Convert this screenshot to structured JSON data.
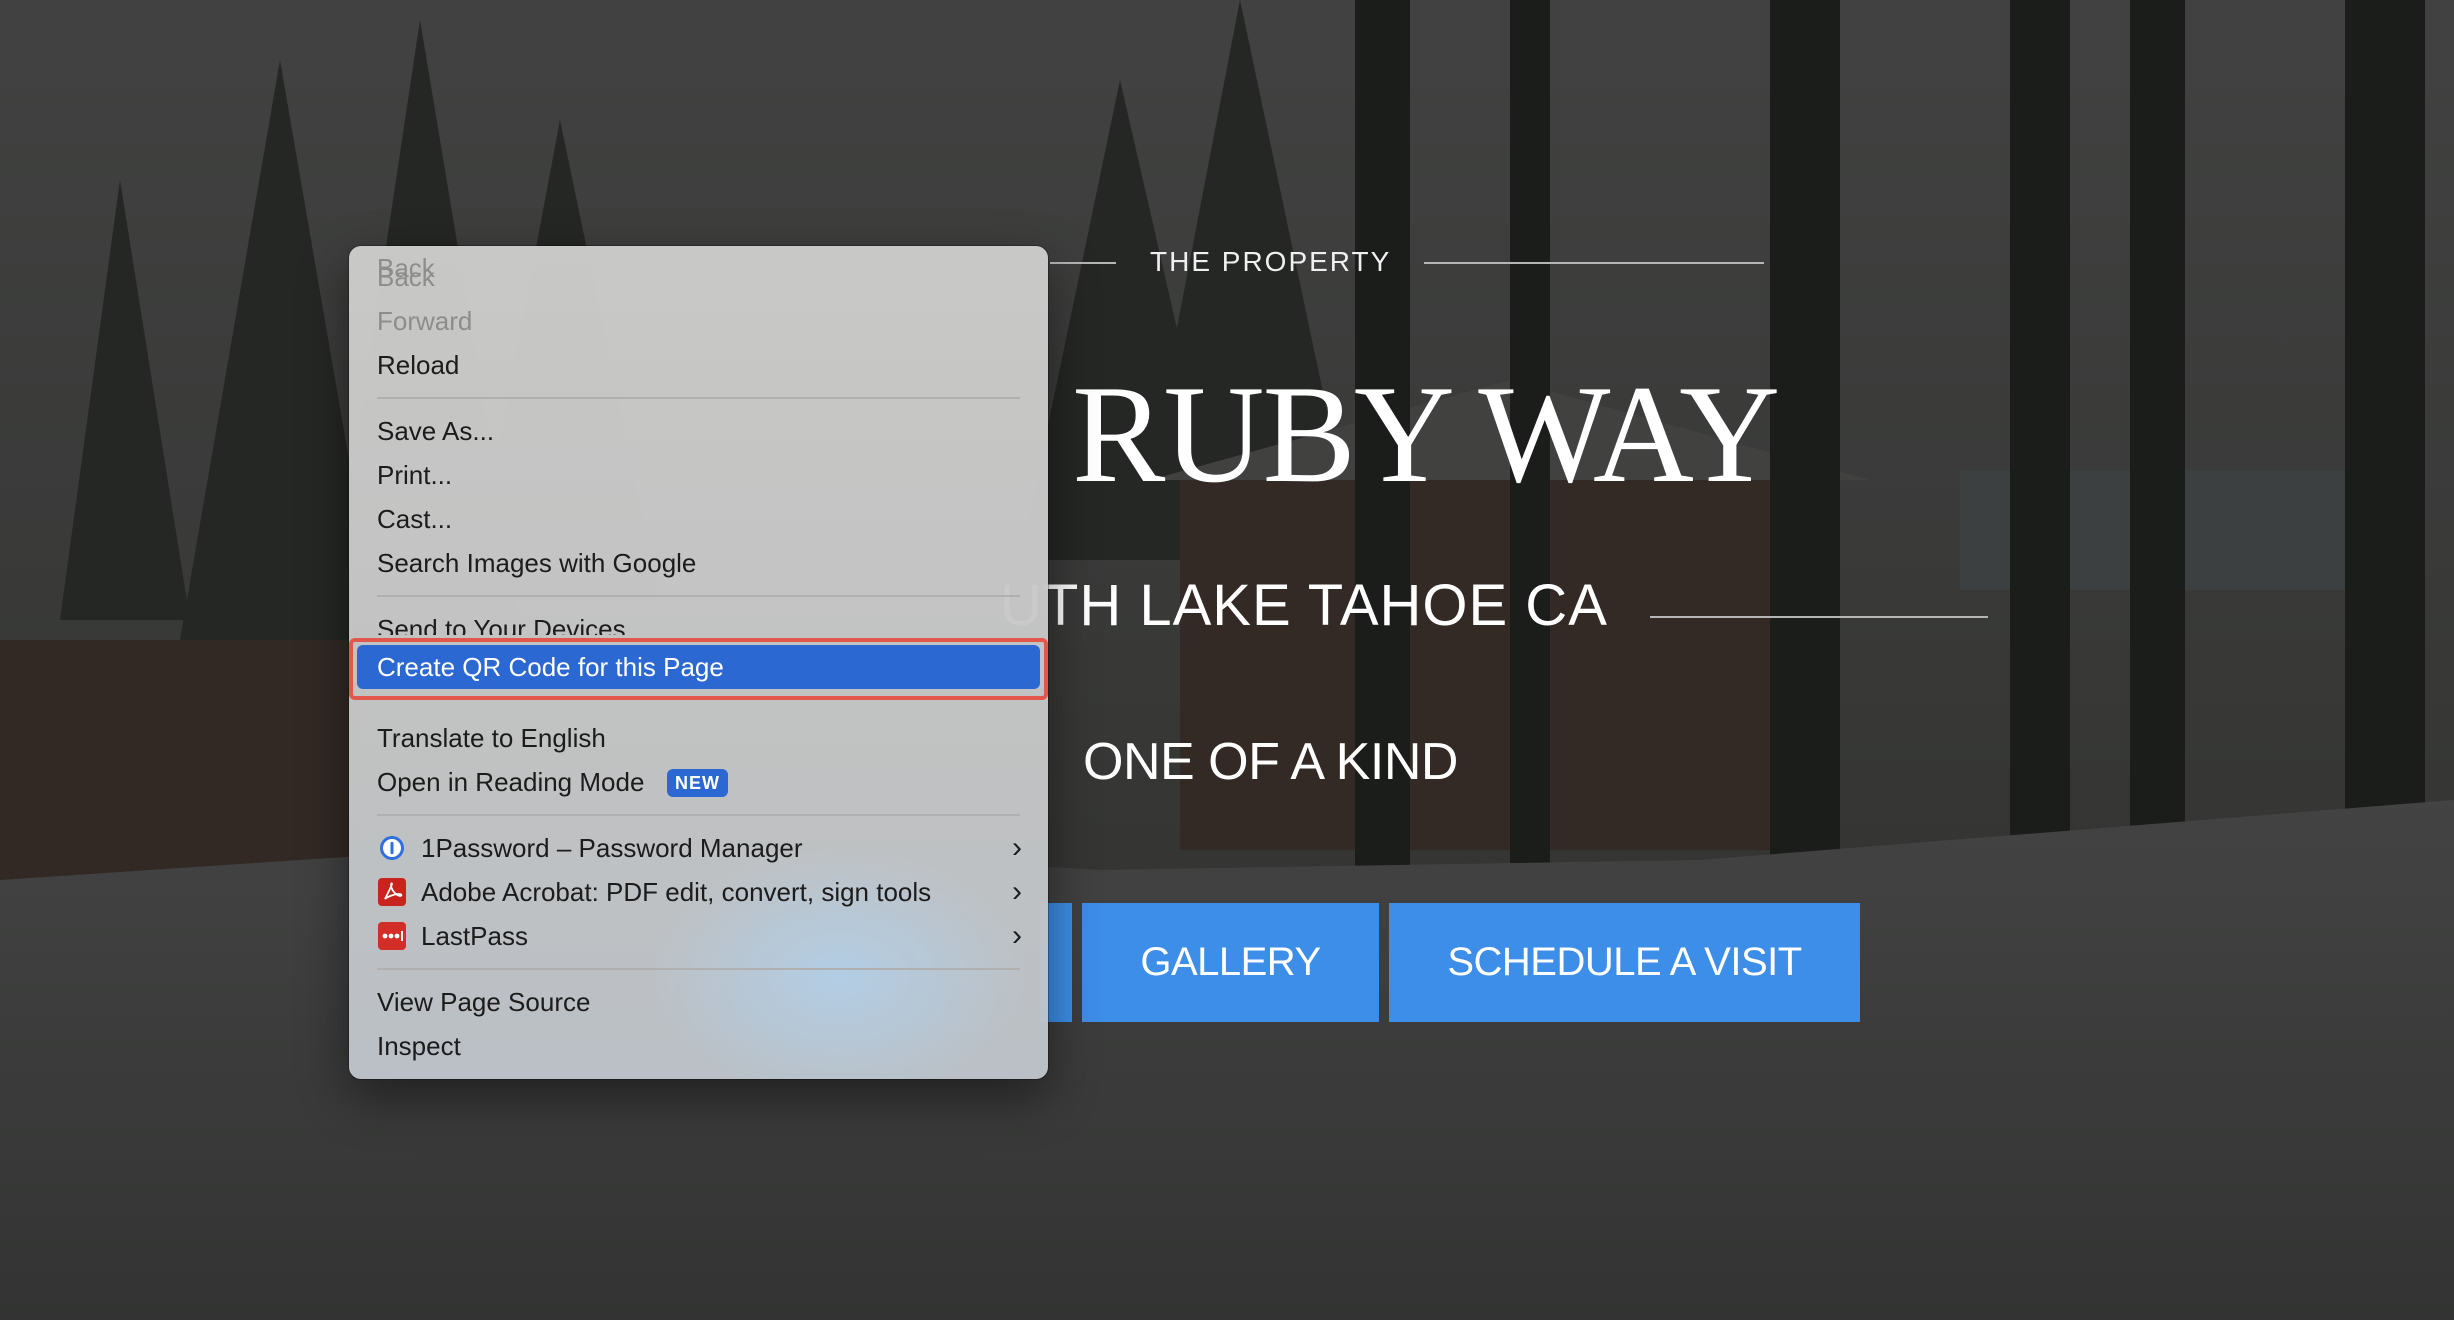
{
  "page": {
    "eyebrow": "THE PROPERTY",
    "title": "RUBY WAY",
    "location": "UTH LAKE TAHOE CA",
    "tagline": "ONE OF A KIND",
    "buttons": {
      "gallery": "GALLERY",
      "schedule": "SCHEDULE A VISIT"
    }
  },
  "context_menu": {
    "back": "Back",
    "forward": "Forward",
    "reload": "Reload",
    "save_as": "Save As...",
    "print": "Print...",
    "cast": "Cast...",
    "search_images": "Search Images with Google",
    "send_to_devices": "Send to Your Devices",
    "create_qr": "Create QR Code for this Page",
    "translate": "Translate to English",
    "reading_mode": "Open in Reading Mode",
    "reading_mode_badge": "NEW",
    "ext_1password": "1Password – Password Manager",
    "ext_acrobat": "Adobe Acrobat: PDF edit, convert, sign tools",
    "ext_lastpass": "LastPass",
    "view_source": "View Page Source",
    "inspect": "Inspect"
  },
  "colors": {
    "highlight": "#2c68d2",
    "annotation_box": "#e2574c",
    "cta": "#3d8ee8"
  },
  "icons": [
    "onepassword-icon",
    "adobe-acrobat-icon",
    "lastpass-icon",
    "chevron-right-icon"
  ]
}
